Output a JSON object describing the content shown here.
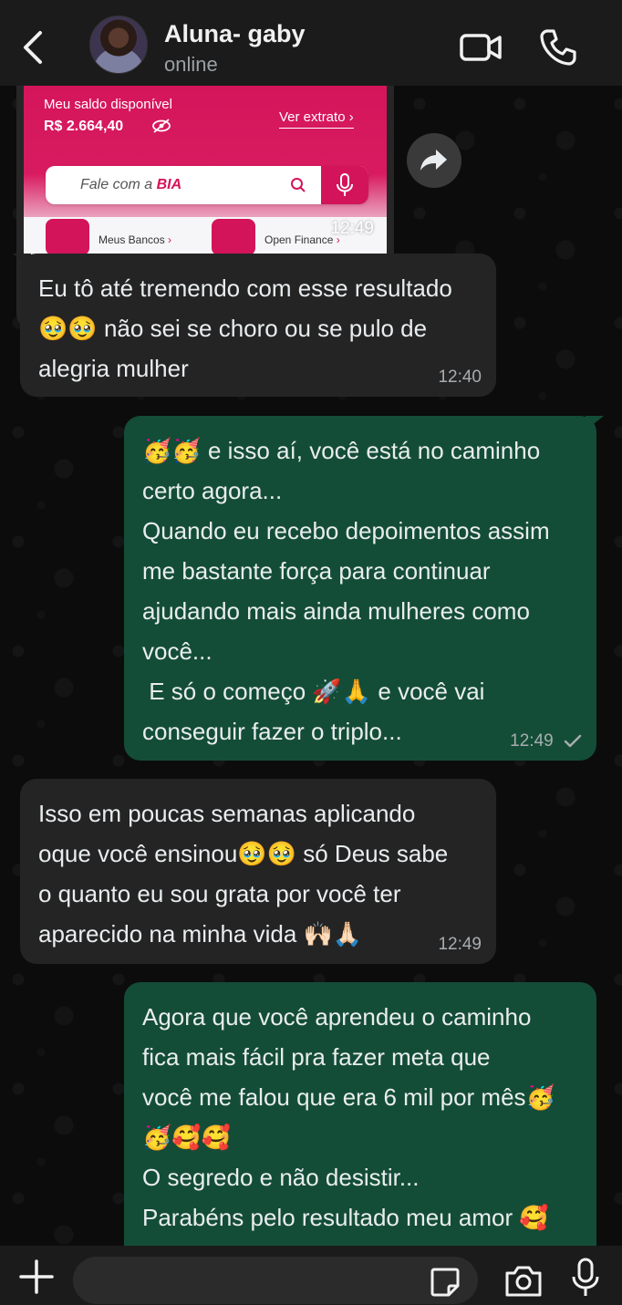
{
  "header": {
    "contact_name": "Aluna- gaby",
    "status": "online"
  },
  "image_message": {
    "balance_label": "Meu saldo disponível",
    "balance_value": "R$ 2.664,40",
    "statement_link": "Ver extrato",
    "search_prefix": "Fale com a ",
    "search_brand": "BIA",
    "link_1": "Meus Bancos",
    "link_2": "Open Finance",
    "time": "12:49",
    "accent_color": "#d4145a"
  },
  "messages": [
    {
      "direction": "incoming",
      "text": "Eu tô até tremendo com esse resultado\n🥹🥹 não sei se choro ou se pulo de\nalegria mulher",
      "time": "12:40"
    },
    {
      "direction": "outgoing",
      "text": "🥳🥳 e isso aí, você está no caminho\ncerto agora...\nQuando eu recebo depoimentos assim\nme bastante força para continuar\najudando mais ainda mulheres como\nvocê...\n E só o começo 🚀🙏 e você vai\nconseguir fazer o triplo...",
      "time": "12:49",
      "status_icon": "single-check-icon"
    },
    {
      "direction": "incoming",
      "text": "Isso em poucas semanas aplicando\noque você ensinou🥹🥹 só Deus sabe\no quanto eu sou grata por você ter\naparecido na minha vida 🙌🏻🙏🏻",
      "time": "12:49"
    },
    {
      "direction": "outgoing",
      "text": "Agora que você aprendeu o caminho\nfica mais fácil pra fazer meta que\nvocê me falou que era 6 mil por mês🥳\n🥳🥰🥰\nO segredo e não desistir...\nParabéns pelo resultado meu amor 🥰",
      "time": ""
    }
  ],
  "composer": {
    "placeholder": ""
  },
  "colors": {
    "incoming_bubble": "#242424",
    "outgoing_bubble": "#144d37",
    "header_bg": "#1b1b1b"
  }
}
